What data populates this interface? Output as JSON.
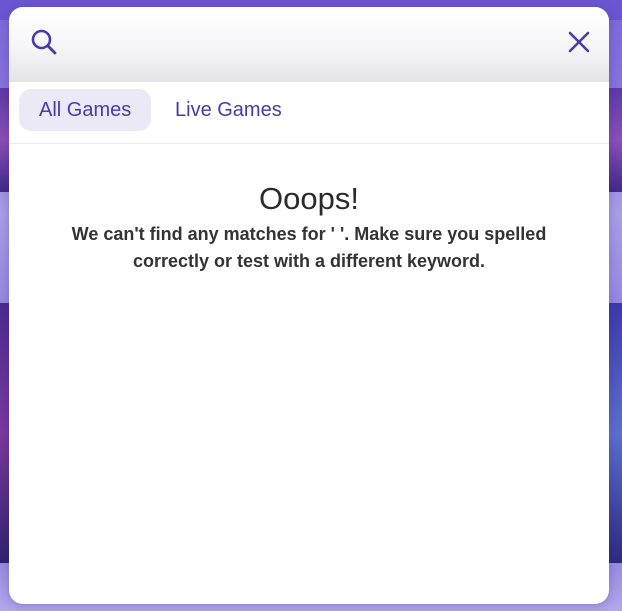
{
  "search": {
    "value": "",
    "placeholder": ""
  },
  "tabs": [
    {
      "label": "All Games",
      "active": true
    },
    {
      "label": "Live Games",
      "active": false
    }
  ],
  "empty_state": {
    "title": "Ooops!",
    "message": "We can't find any matches for ' '. Make sure you spelled correctly or test with a different keyword."
  },
  "icons": {
    "search": "search-icon",
    "close": "close-icon"
  },
  "colors": {
    "accent": "#4a3aa8",
    "tab_active_bg": "#ebe9f6",
    "backdrop": "#7c66d9"
  }
}
